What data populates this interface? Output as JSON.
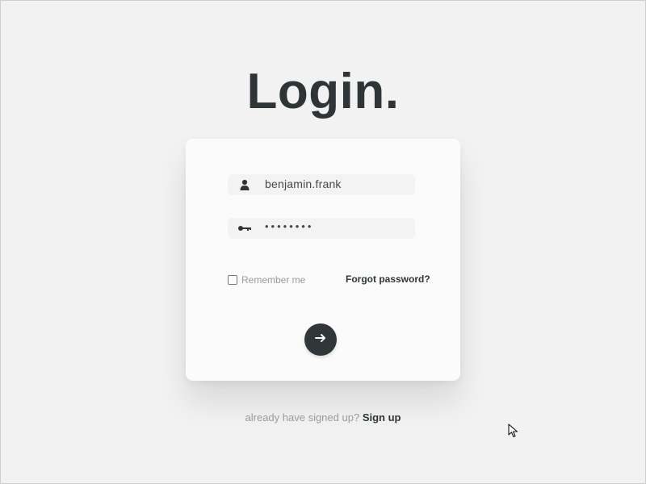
{
  "page": {
    "title": "Login."
  },
  "form": {
    "username_value": "benjamin.frank",
    "password_value": "••••••••",
    "remember_label": "Remember me",
    "forgot_label": "Forgot password?",
    "submit_icon": "arrow-right-icon"
  },
  "footer": {
    "prompt_text": "already have signed up?",
    "signup_label": "Sign up"
  },
  "icons": {
    "username": "user-icon",
    "password": "key-icon",
    "cursor": "cursor-icon"
  },
  "colors": {
    "background": "#f2f2f2",
    "card": "#fbfbfb",
    "primary_text": "#2f3537",
    "muted_text": "#9a9a9a",
    "button": "#313638"
  }
}
